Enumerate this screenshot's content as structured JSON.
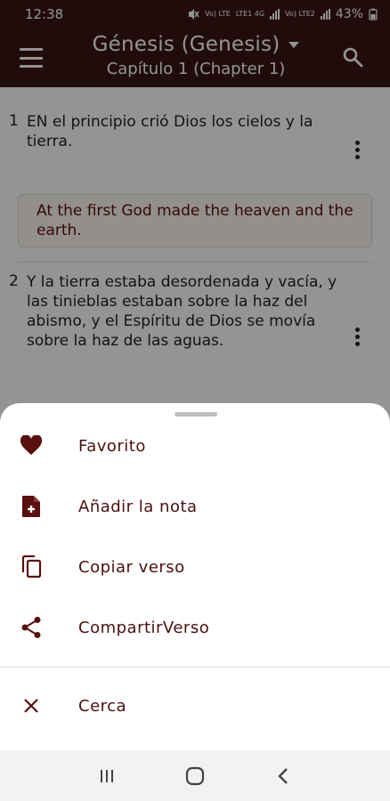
{
  "status_bar": {
    "time": "12:38",
    "net_label_1": "Vo) LTE",
    "net_label_2": "LTE1 4G",
    "net_label_3": "Vo) LTE2",
    "battery": "43%"
  },
  "app_bar": {
    "title": "Génesis (Genesis)",
    "subtitle": "Capítulo 1 (Chapter 1)",
    "color": "#3a1616"
  },
  "verses": [
    {
      "number": "1",
      "text": "EN el principio crió Dios los cielos y la tierra.",
      "translation": "At the first God made the heaven and the earth."
    },
    {
      "number": "2",
      "text": "Y la tierra estaba desordenada y vacía, y las tinieblas estaban sobre la haz del abismo, y el Espíritu de Dios se movía sobre la haz de las aguas."
    }
  ],
  "sheet": {
    "items": [
      {
        "label": "Favorito",
        "icon": "heart-icon"
      },
      {
        "label": "Añadir la nota",
        "icon": "note-add-icon"
      },
      {
        "label": "Copiar verso",
        "icon": "copy-icon"
      },
      {
        "label": "CompartirVerso",
        "icon": "share-icon"
      },
      {
        "label": "Cerca",
        "icon": "close-icon"
      }
    ],
    "accent": "#5a0f0f"
  },
  "nav_bar": {
    "buttons": [
      "recents-button",
      "home-button",
      "back-button"
    ]
  }
}
